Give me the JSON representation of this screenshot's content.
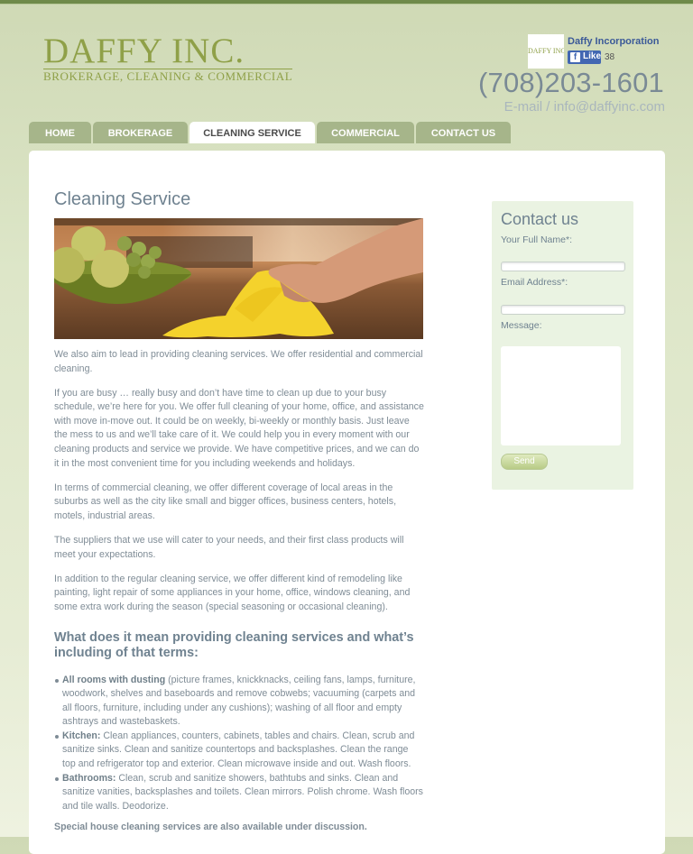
{
  "header": {
    "logo_name": "DAFFY INC.",
    "logo_tagline": "BROKERAGE, CLEANING & COMMERCIAL",
    "phone": "(708)203-1601",
    "email_line": "E-mail / info@daffyinc.com",
    "facebook": {
      "thumb_text": "DAFFY INC.",
      "page_name": "Daffy Incorporation",
      "like_label": "Like",
      "like_count": "38"
    }
  },
  "nav": {
    "items": [
      {
        "label": "HOME"
      },
      {
        "label": "BROKERAGE"
      },
      {
        "label": "CLEANING SERVICE"
      },
      {
        "label": "COMMERCIAL"
      },
      {
        "label": "CONTACT US"
      }
    ],
    "active": "CLEANING SERVICE"
  },
  "main": {
    "title": "Cleaning Service",
    "paragraphs": [
      "We also aim to lead in providing cleaning services. We offer residential and commercial cleaning.",
      "If you are busy … really busy and don’t have time to clean up due to your busy schedule, we’re here for you. We offer full cleaning of your home, office, and assistance with move in-move out. It could be on weekly, bi-weekly or monthly basis. Just leave the mess to us and we’ll take care of it. We could help you in every moment with our cleaning products and service we provide. We have competitive prices, and we can do it in the most convenient time for you including weekends and holidays.",
      "In terms of commercial cleaning, we offer different coverage of local areas in the suburbs as well as the city like small and bigger offices, business centers, hotels, motels, industrial areas.",
      "The suppliers that we use will cater to your needs, and their first class products will meet your expectations.",
      "In addition to the regular cleaning service, we offer different kind of remodeling like painting, light repair of some appliances in your home, office, windows cleaning, and some extra work during the season (special seasoning or occasional cleaning)."
    ],
    "subheading": "What does it mean providing cleaning services and what’s including of that terms:",
    "list": [
      {
        "title": "All rooms with dusting",
        "text": " (picture frames, knickknacks, ceiling fans, lamps, furniture, woodwork, shelves and baseboards and remove cobwebs; vacuuming (carpets and all floors, furniture, including under any cushions); washing of all floor and empty ashtrays and wastebaskets."
      },
      {
        "title": "Kitchen:",
        "text": " Clean appliances, counters, cabinets, tables and chairs. Clean, scrub and sanitize sinks. Clean and sanitize countertops and backsplashes. Clean the range top and refrigerator top and exterior. Clean microwave inside and out. Wash floors."
      },
      {
        "title": "Bathrooms:",
        "text": " Clean, scrub and sanitize showers, bathtubs and sinks. Clean and sanitize vanities, backsplashes and toilets. Clean mirrors. Polish chrome. Wash floors and tile walls. Deodorize."
      }
    ],
    "closing": "Special house cleaning services are also available under discussion."
  },
  "contact": {
    "title": "Contact us",
    "name_label": "Your Full Name*:",
    "name_value": "",
    "email_label": "Email Address*:",
    "email_value": "",
    "message_label": "Message:",
    "message_value": "",
    "send_label": "Send"
  },
  "colors": {
    "logo_green": "#8fa048",
    "tab_green": "#a6b58a",
    "heading_slate": "#6f8290",
    "body_text": "#7f8c96",
    "sidebar_bg": "#eaf3e2",
    "facebook_blue": "#3b5998"
  }
}
